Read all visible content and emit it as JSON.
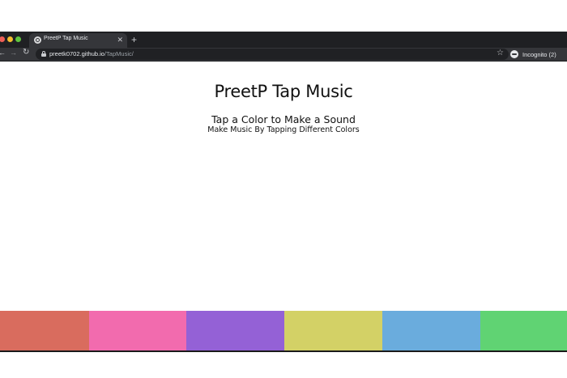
{
  "browser": {
    "tab": {
      "title": "PreetP Tap Music",
      "close_glyph": "✕",
      "favicon": "globe-icon"
    },
    "new_tab_glyph": "+",
    "nav": {
      "back_glyph": "←",
      "forward_glyph": "→",
      "reload_glyph": "↻"
    },
    "address": {
      "host": "preetk0702.github.io",
      "path": "/TapMusic/"
    },
    "bookmark_glyph": "☆",
    "profile": {
      "label": "Incognito (2)",
      "icon": "incognito-icon"
    },
    "colors": {
      "frame": "#1f2023",
      "toolbar": "#35363a",
      "omnibox": "#202124"
    }
  },
  "page": {
    "title": "PreetP Tap Music",
    "heading": "Tap a Color to Make a Sound",
    "subheading": "Make Music By Tapping Different Colors"
  },
  "pads": [
    {
      "name": "pad-1",
      "color": "#d96c5e"
    },
    {
      "name": "pad-2",
      "color": "#f26bae"
    },
    {
      "name": "pad-3",
      "color": "#9461d6"
    },
    {
      "name": "pad-4",
      "color": "#d3d166"
    },
    {
      "name": "pad-5",
      "color": "#6aacdd"
    },
    {
      "name": "pad-6",
      "color": "#60d373"
    }
  ]
}
